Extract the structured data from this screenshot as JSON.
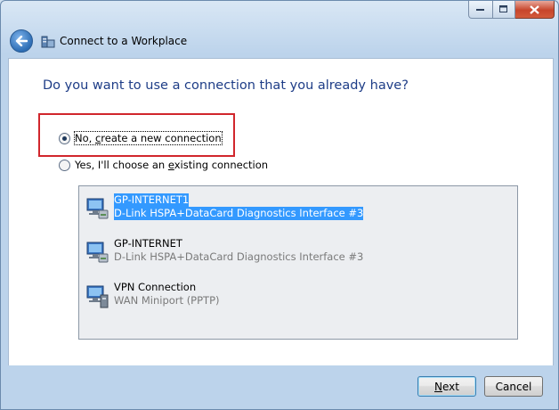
{
  "window": {
    "title": "Connect to a Workplace"
  },
  "heading": "Do you want to use a connection that you already have?",
  "options": [
    {
      "label_pre": "No, ",
      "label_ul": "c",
      "label_post": "reate a new connection",
      "selected": true
    },
    {
      "label_pre": "Yes, I'll choose an ",
      "label_ul": "e",
      "label_post": "xisting connection",
      "selected": false
    }
  ],
  "connections": [
    {
      "name": "GP-INTERNET1",
      "device": "D-Link HSPA+DataCard Diagnostics Interface #3",
      "icon": "network-modem-icon"
    },
    {
      "name": "GP-INTERNET",
      "device": "D-Link HSPA+DataCard Diagnostics Interface #3",
      "icon": "network-modem-icon"
    },
    {
      "name": "VPN Connection",
      "device": "WAN Miniport (PPTP)",
      "icon": "network-vpn-icon"
    }
  ],
  "buttons": {
    "next_ul": "N",
    "next_rest": "ext",
    "cancel": "Cancel"
  },
  "colors": {
    "heading": "#1e3d87",
    "highlight_border": "#d1262c",
    "selection": "#3399ff"
  }
}
